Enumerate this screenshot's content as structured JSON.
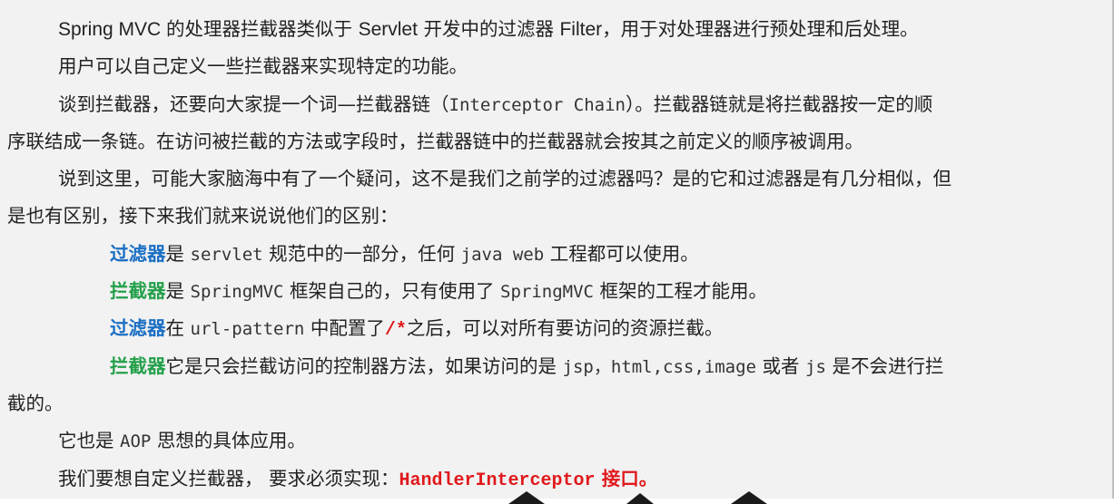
{
  "paragraphs": {
    "p1": {
      "a": "Spring MVC ",
      "b": "的处理器拦截器类似于 ",
      "c": "Servlet",
      "d": " 开发中的过滤器 ",
      "e": "Filter",
      "f": "，用于对处理器进行预处理和后处理。"
    },
    "p2": "用户可以自己定义一些拦截器来实现特定的功能。",
    "p3": {
      "line1_a": "谈到拦截器，还要向大家提一个词—拦截器链（",
      "line1_b": "Interceptor Chain",
      "line1_c": "）。拦截器链就是将拦截器按一定的顺",
      "line2": "序联结成一条链。在访问被拦截的方法或字段时，拦截器链中的拦截器就会按其之前定义的顺序被调用。"
    },
    "p4": {
      "line1": "说到这里，可能大家脑海中有了一个疑问，这不是我们之前学的过滤器吗？是的它和过滤器是有几分相似，但",
      "line2": "是也有区别，接下来我们就来说说他们的区别："
    },
    "list": {
      "item1": {
        "term": "过滤器",
        "a": "是 ",
        "code1": "servlet",
        "b": " 规范中的一部分，任何 ",
        "code2": "java web",
        "c": " 工程都可以使用。"
      },
      "item2": {
        "term": "拦截器",
        "a": "是 ",
        "code1": "SpringMVC",
        "b": " 框架自己的，只有使用了 ",
        "code2": "SpringMVC",
        "c": " 框架的工程才能用。"
      },
      "item3": {
        "term": "过滤器",
        "a": "在 ",
        "code1": "url-pattern",
        "b": " 中配置了",
        "highlight": "/*",
        "c": "之后，可以对所有要访问的资源拦截。"
      },
      "item4": {
        "term": "拦截器",
        "a": "它是只会拦截访问的控制器方法，如果访问的是 ",
        "code1": "jsp，html,css,image",
        "b": " 或者 ",
        "code2": "js",
        "c": " 是不会进行拦",
        "line2": "截的。"
      }
    },
    "p5": {
      "a": "它也是 ",
      "code": "AOP",
      "b": " 思想的具体应用。"
    },
    "p6": {
      "a": "我们要想自定义拦截器，  要求必须实现：",
      "code": "HandlerInterceptor",
      "b": " 接口。"
    }
  },
  "colors": {
    "background": "#f2f2f2",
    "text": "#222222",
    "filter_term": "#1a6fc4",
    "interceptor_term": "#23a04a",
    "highlight_red": "#e0191c"
  }
}
